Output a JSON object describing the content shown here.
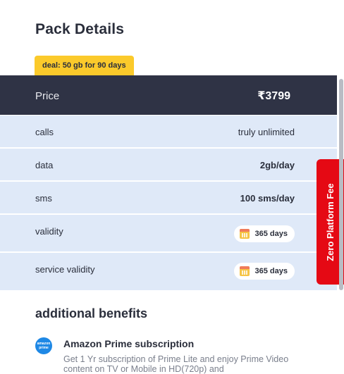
{
  "header": {
    "title": "Pack Details",
    "deal_badge": "deal: 50 gb for 90 days"
  },
  "price": {
    "label": "Price",
    "value": "₹3799"
  },
  "details": [
    {
      "label": "calls",
      "value": "truly unlimited",
      "style": "plain"
    },
    {
      "label": "data",
      "value": "2gb/day",
      "style": "bold"
    },
    {
      "label": "sms",
      "value": "100 sms/day",
      "style": "bold"
    },
    {
      "label": "validity",
      "value": "365 days",
      "style": "chip",
      "icon": "calendar-icon"
    },
    {
      "label": "service validity",
      "value": "365 days",
      "style": "chip",
      "icon": "calendar-icon"
    }
  ],
  "side_tab": {
    "label": "Zero Platform Fee"
  },
  "additional_benefits": {
    "title": "additional benefits",
    "items": [
      {
        "logo_text": "amazon prime",
        "title": "Amazon Prime subscription",
        "description": "Get 1 Yr subscription of Prime Lite and enjoy Prime Video content on TV or Mobile in HD(720p) and"
      }
    ]
  },
  "colors": {
    "price_bg": "#2f3345",
    "row_bg": "#dfe9f8",
    "deal_bg": "#fbca2b",
    "side_tab_bg": "#e50914",
    "prime_logo_bg": "#1e88e5"
  }
}
